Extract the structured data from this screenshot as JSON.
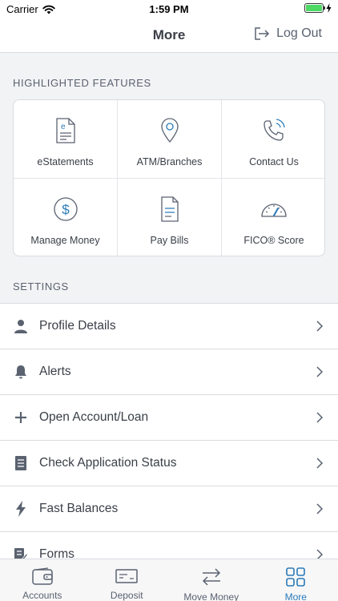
{
  "status_bar": {
    "carrier": "Carrier",
    "time": "1:59 PM"
  },
  "header": {
    "title": "More",
    "logout_label": "Log Out"
  },
  "features": {
    "heading": "HIGHLIGHTED FEATURES",
    "items": [
      {
        "label": "eStatements",
        "icon": "document-e-icon"
      },
      {
        "label": "ATM/Branches",
        "icon": "location-pin-icon"
      },
      {
        "label": "Contact Us",
        "icon": "phone-icon"
      },
      {
        "label": "Manage Money",
        "icon": "dollar-circle-icon"
      },
      {
        "label": "Pay Bills",
        "icon": "bill-document-icon"
      },
      {
        "label": "FICO® Score",
        "icon": "gauge-icon"
      }
    ]
  },
  "settings": {
    "heading": "SETTINGS",
    "items": [
      {
        "label": "Profile Details",
        "icon": "person-icon"
      },
      {
        "label": "Alerts",
        "icon": "bell-icon"
      },
      {
        "label": "Open Account/Loan",
        "icon": "plus-icon"
      },
      {
        "label": "Check Application Status",
        "icon": "document-icon"
      },
      {
        "label": "Fast Balances",
        "icon": "lightning-icon"
      },
      {
        "label": "Forms",
        "icon": "form-edit-icon"
      }
    ]
  },
  "tabs": {
    "active": "More",
    "items": [
      {
        "label": "Accounts",
        "icon": "wallet-icon"
      },
      {
        "label": "Deposit",
        "icon": "check-deposit-icon"
      },
      {
        "label": "Move Money",
        "icon": "transfer-arrows-icon"
      },
      {
        "label": "More",
        "icon": "grid-icon"
      }
    ]
  },
  "colors": {
    "accent": "#2a7ab8",
    "icon_gray": "#5a6270",
    "background": "#f2f3f5"
  }
}
